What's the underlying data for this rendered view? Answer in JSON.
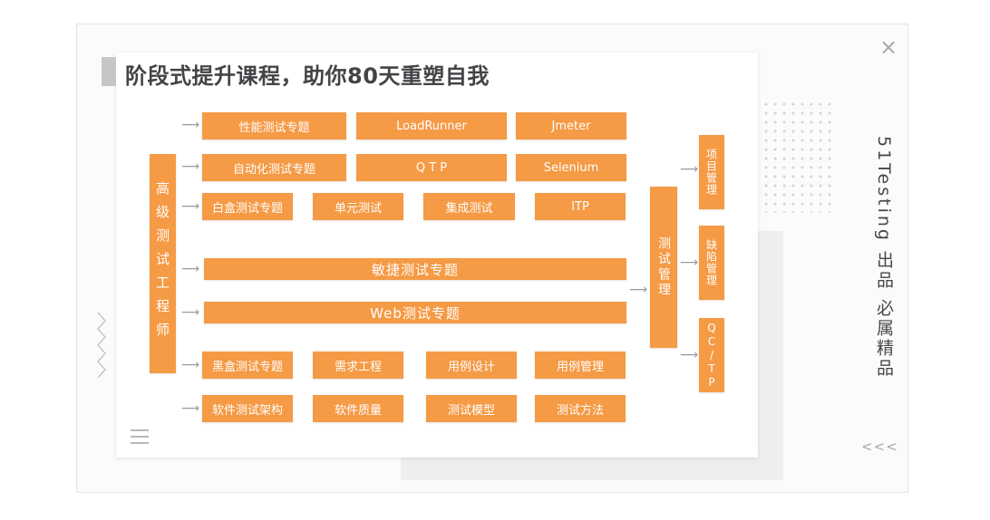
{
  "title": "阶段式提升课程，助你80天重塑自我",
  "left_vertical": "高级测试工程师",
  "rows": [
    [
      "性能测试专题",
      "LoadRunner",
      "Jmeter"
    ],
    [
      "自动化测试专题",
      "Q T P",
      "Selenium"
    ],
    [
      "白盒测试专题",
      "单元测试",
      "集成测试",
      "ITP"
    ],
    [
      "敏捷测试专题"
    ],
    [
      "Web测试专题"
    ],
    [
      "黑盒测试专题",
      "需求工程",
      "用例设计",
      "用例管理"
    ],
    [
      "软件测试架构",
      "软件质量",
      "测试模型",
      "测试方法"
    ]
  ],
  "center_vertical": "测试管理",
  "right_boxes": [
    "项目管理",
    "缺陷管理",
    "QC/TP"
  ],
  "side_brand": "51Testing 出品",
  "side_tagline": "必属精品",
  "close_glyph": "×",
  "chevrons": "<<<",
  "colors": {
    "accent": "#f59a45",
    "title": "#444448"
  },
  "icons": [
    "close-icon",
    "menu-icon",
    "chevrons-left-icon",
    "zigzag-decoration",
    "arrow-right-icon"
  ]
}
